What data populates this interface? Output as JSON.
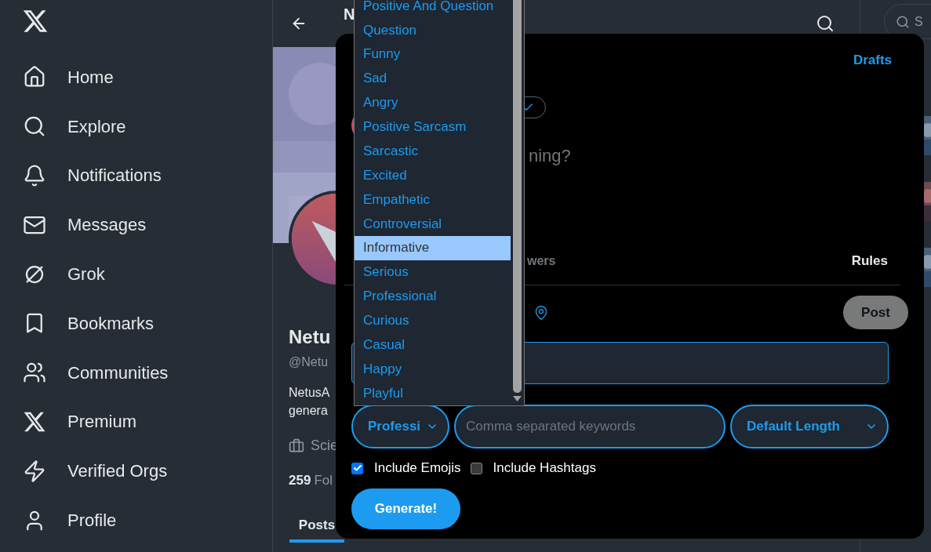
{
  "sidebar": {
    "items": [
      {
        "label": "Home"
      },
      {
        "label": "Explore"
      },
      {
        "label": "Notifications"
      },
      {
        "label": "Messages"
      },
      {
        "label": "Grok"
      },
      {
        "label": "Bookmarks"
      },
      {
        "label": "Communities"
      },
      {
        "label": "Premium"
      },
      {
        "label": "Verified Orgs"
      },
      {
        "label": "Profile"
      }
    ]
  },
  "profile": {
    "title": "N",
    "name": "Netu",
    "handle": "@Netu",
    "bio": [
      "NetusA",
      "genera"
    ],
    "category": "Scie",
    "count": "259",
    "count_label": "Fol",
    "tabs": [
      {
        "label": "Posts",
        "selected": true
      }
    ]
  },
  "right_column": {
    "search_placeholder": "S"
  },
  "composer": {
    "drafts": "Drafts",
    "placeholder": "ning?",
    "reply_setting": "wers",
    "rules": "Rules",
    "post_button": {
      "label": "Post",
      "disabled": true
    },
    "tone_select": {
      "value": "Professi"
    },
    "keywords": {
      "placeholder": "Comma separated keywords"
    },
    "length_select": {
      "value": "Default Length"
    },
    "options": [
      {
        "label": "Include Emojis",
        "checked": true
      },
      {
        "label": "Include Hashtags",
        "checked": false
      }
    ],
    "generate_button": "Generate!"
  },
  "tone_dropdown": {
    "options": [
      {
        "label": "Positive And Question",
        "selected": false
      },
      {
        "label": "Question",
        "selected": false
      },
      {
        "label": "Funny",
        "selected": false
      },
      {
        "label": "Sad",
        "selected": false
      },
      {
        "label": "Angry",
        "selected": false
      },
      {
        "label": "Positive Sarcasm",
        "selected": false
      },
      {
        "label": "Sarcastic",
        "selected": false
      },
      {
        "label": "Excited",
        "selected": false
      },
      {
        "label": "Empathetic",
        "selected": false
      },
      {
        "label": "Controversial",
        "selected": false
      },
      {
        "label": "Informative",
        "selected": true
      },
      {
        "label": "Serious",
        "selected": false
      },
      {
        "label": "Professional",
        "selected": false
      },
      {
        "label": "Curious",
        "selected": false
      },
      {
        "label": "Casual",
        "selected": false
      },
      {
        "label": "Happy",
        "selected": false
      },
      {
        "label": "Playful",
        "selected": false
      }
    ]
  }
}
